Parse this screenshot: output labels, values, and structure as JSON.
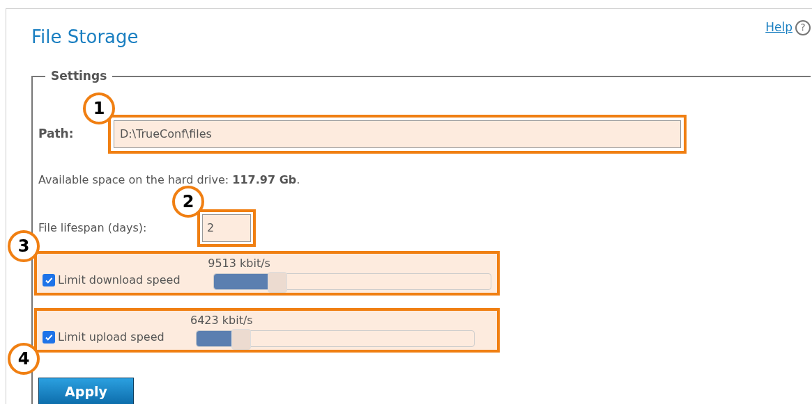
{
  "title": "File Storage",
  "help": {
    "label": "Help",
    "icon": "?"
  },
  "settings": {
    "legend": "Settings",
    "path": {
      "label": "Path:",
      "value": "D:\\TrueConf\\files",
      "callout": "1"
    },
    "available": "Available space on the hard drive: **117.97 Gb**.",
    "lifespan": {
      "label": "File lifespan (days):",
      "value": "2",
      "callout": "2"
    },
    "limits": [
      {
        "label": "Limit download speed",
        "checked": true,
        "reading": "9513 kbit/s",
        "level": 0.23,
        "callout": "3"
      },
      {
        "label": "Limit upload speed",
        "checked": true,
        "reading": "6423 kbit/s",
        "level": 0.16,
        "callout": "4"
      }
    ],
    "apply": "Apply"
  }
}
